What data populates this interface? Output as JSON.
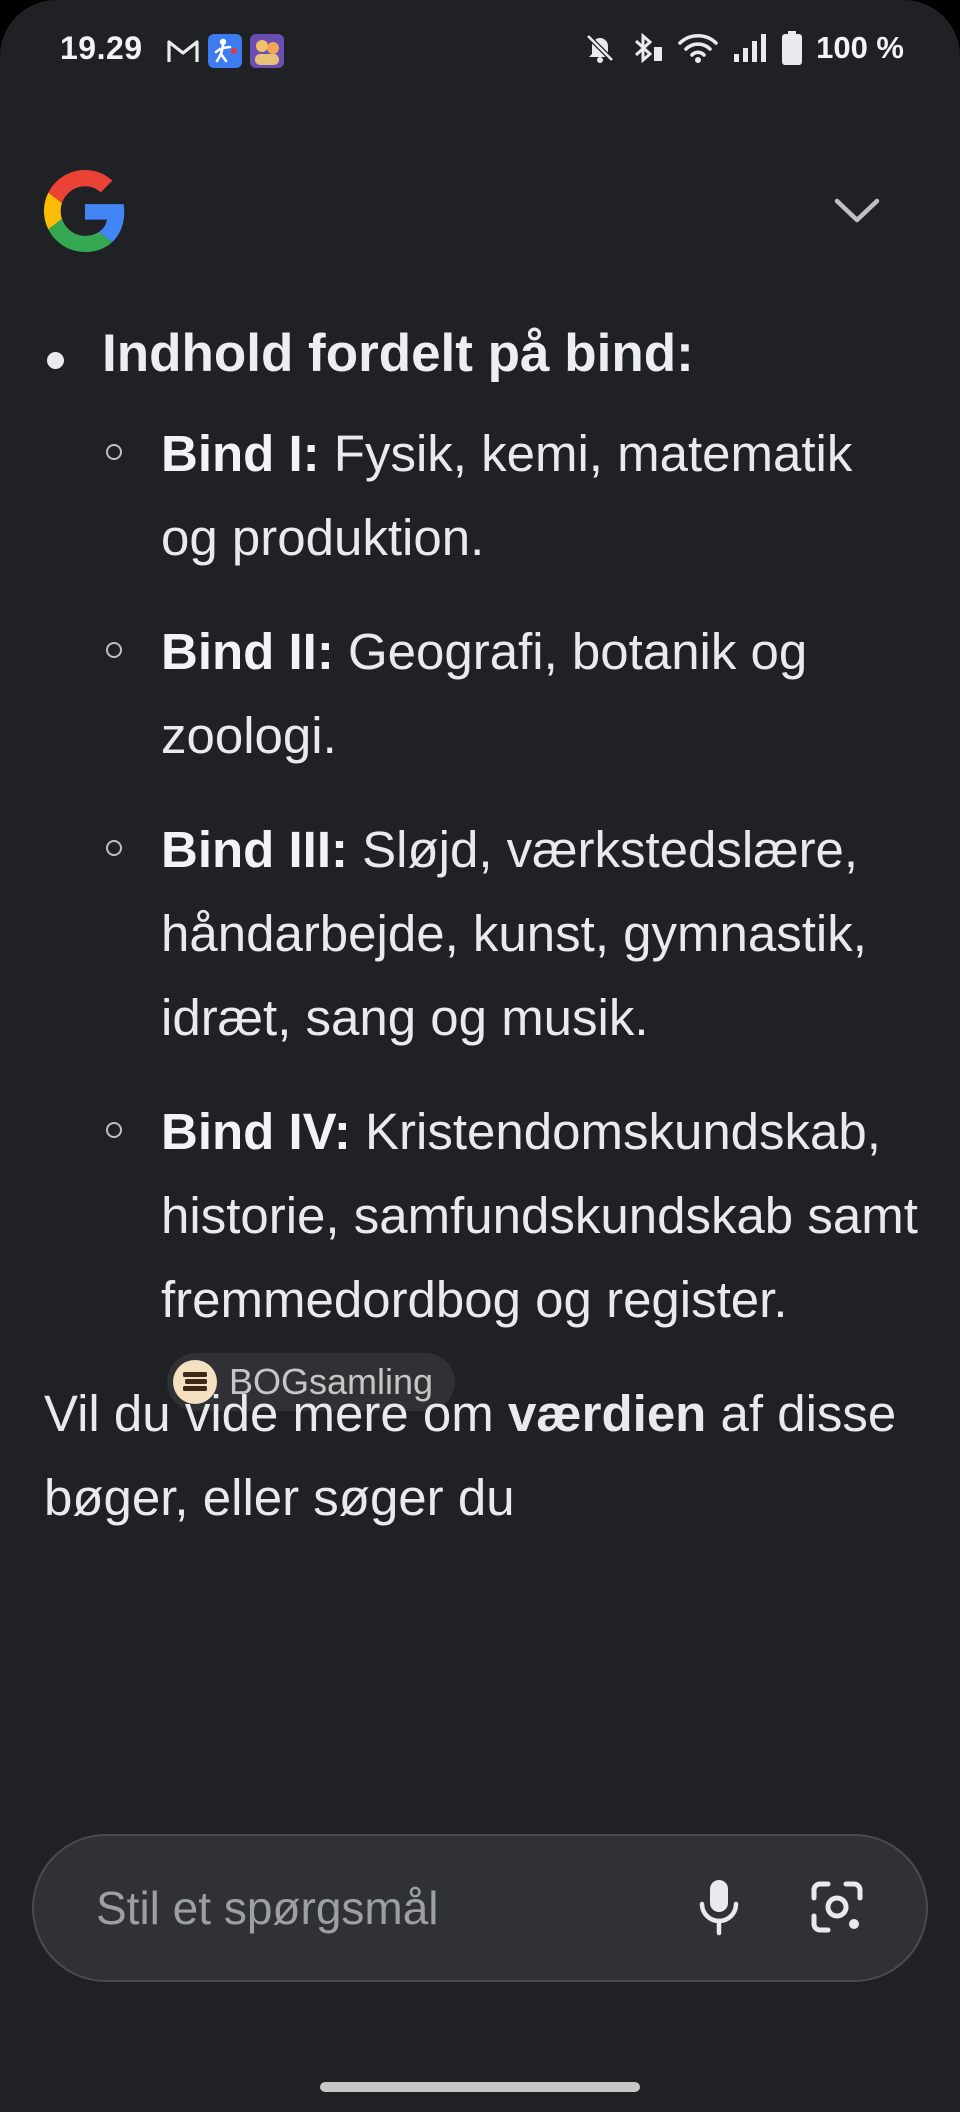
{
  "status_bar": {
    "time": "19.29",
    "left_icons": [
      "gmail-icon",
      "accessibility-icon",
      "app-avatar-icon"
    ],
    "right_icons": [
      "mute-icon",
      "bluetooth-icon",
      "wifi-icon",
      "signal-icon",
      "battery-icon"
    ],
    "battery": "100 %"
  },
  "header": {
    "logo": "google-g-logo",
    "collapse_icon": "chevron-down-icon"
  },
  "answer": {
    "heading": "Indhold fordelt på bind:",
    "volumes": [
      {
        "label": "Bind I:",
        "text": " Fysik, kemi, matematik og produktion."
      },
      {
        "label": "Bind II:",
        "text": " Geografi, botanik og zoologi."
      },
      {
        "label": "Bind III:",
        "text": " Sløjd, værkstedslære, håndarbejde, kunst, gymnastik, idræt, sang og musik."
      },
      {
        "label": "Bind IV:",
        "text": " Kristendomskundskab, historie, samfundskundskab samt fremmedordbog og register."
      }
    ],
    "source_chip": "BOGsamling",
    "follow_up_pre": "Vil du vide mere om ",
    "follow_up_bold": "værdien",
    "follow_up_post": " af disse bøger, eller søger du"
  },
  "ask_bar": {
    "placeholder": "Stil et spørgsmål",
    "mic_icon": "microphone-icon",
    "lens_icon": "camera-lens-icon"
  },
  "colors": {
    "background": "#202124",
    "text": "#e8eaed",
    "chip_bg": "#303134",
    "google_blue": "#4285F4",
    "google_red": "#EA4335",
    "google_yellow": "#FBBC05",
    "google_green": "#34A853"
  }
}
